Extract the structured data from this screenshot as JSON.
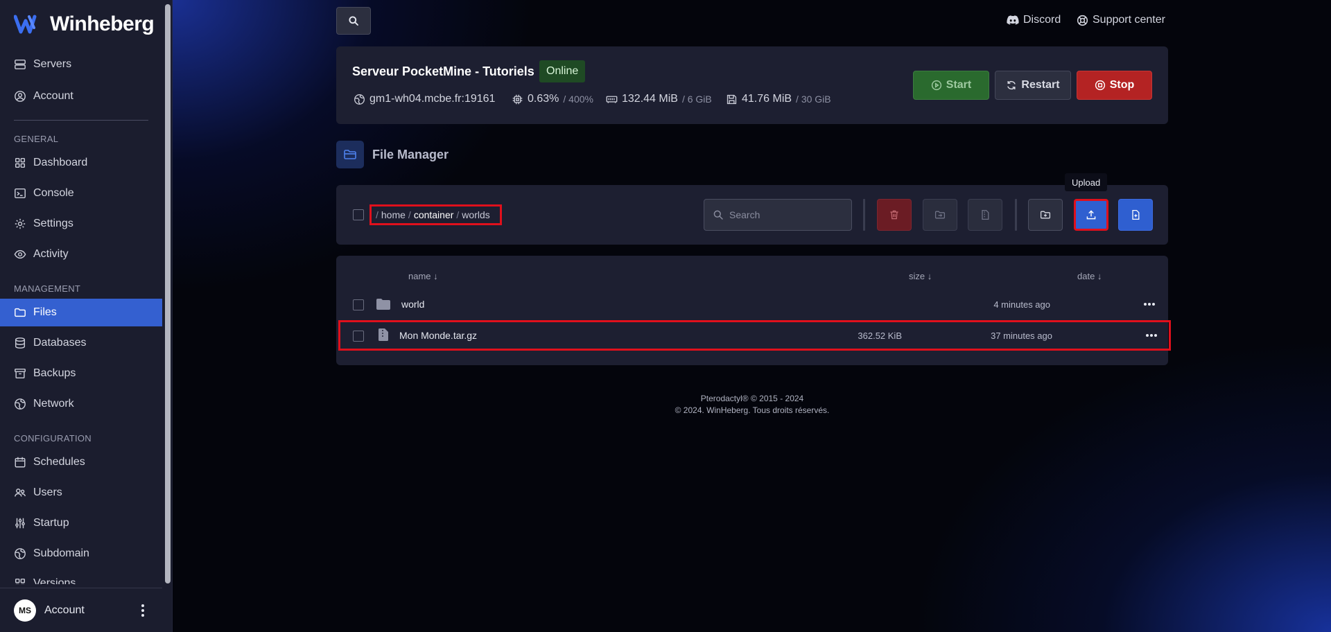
{
  "app": {
    "brand": "Winheberg"
  },
  "sidebar": {
    "top_items": [
      {
        "label": "Servers",
        "icon": "server-icon"
      },
      {
        "label": "Account",
        "icon": "user-circle-icon"
      }
    ],
    "sections": [
      {
        "title": "GENERAL",
        "items": [
          {
            "label": "Dashboard",
            "icon": "grid-icon"
          },
          {
            "label": "Console",
            "icon": "terminal-icon"
          },
          {
            "label": "Settings",
            "icon": "gear-icon"
          },
          {
            "label": "Activity",
            "icon": "eye-icon"
          }
        ]
      },
      {
        "title": "MANAGEMENT",
        "items": [
          {
            "label": "Files",
            "icon": "folder-icon",
            "active": true
          },
          {
            "label": "Databases",
            "icon": "database-icon"
          },
          {
            "label": "Backups",
            "icon": "archive-icon"
          },
          {
            "label": "Network",
            "icon": "globe-icon"
          }
        ]
      },
      {
        "title": "CONFIGURATION",
        "items": [
          {
            "label": "Schedules",
            "icon": "calendar-icon"
          },
          {
            "label": "Users",
            "icon": "users-icon"
          },
          {
            "label": "Startup",
            "icon": "sliders-icon"
          },
          {
            "label": "Subdomain",
            "icon": "globe-icon"
          },
          {
            "label": "Versions",
            "icon": "grid-icon"
          }
        ]
      }
    ],
    "footer": {
      "avatar_initials": "MS",
      "label": "Account"
    }
  },
  "topbar": {
    "discord_label": "Discord",
    "support_label": "Support center"
  },
  "server": {
    "title": "Serveur PocketMine - Tutoriels",
    "status": "Online",
    "address": "gm1-wh04.mcbe.fr:19161",
    "cpu": "0.63%",
    "cpu_limit": "/ 400%",
    "memory": "132.44 MiB",
    "memory_limit": "/ 6 GiB",
    "disk": "41.76 MiB",
    "disk_limit": "/ 30 GiB",
    "buttons": {
      "start": "Start",
      "restart": "Restart",
      "stop": "Stop"
    }
  },
  "file_manager": {
    "title": "File Manager",
    "breadcrumb": [
      "home",
      "container",
      "worlds"
    ],
    "search_placeholder": "Search",
    "tooltip": "Upload",
    "columns": {
      "name": "name ↓",
      "size": "size ↓",
      "date": "date ↓"
    },
    "files": [
      {
        "name": "world",
        "type": "folder",
        "size": "",
        "date": "4 minutes ago"
      },
      {
        "name": "Mon Monde.tar.gz",
        "type": "file",
        "size": "362.52 KiB",
        "date": "37 minutes ago"
      }
    ]
  },
  "footer": {
    "line1": "Pterodactyl® © 2015 - 2024",
    "line2": "© 2024. WinHeberg. Tous droits réservés."
  },
  "colors": {
    "accent": "#3460d0",
    "highlight": "#e0101c",
    "online": "#1f4a24",
    "stop": "#b42323",
    "start": "#2a6a2e"
  }
}
